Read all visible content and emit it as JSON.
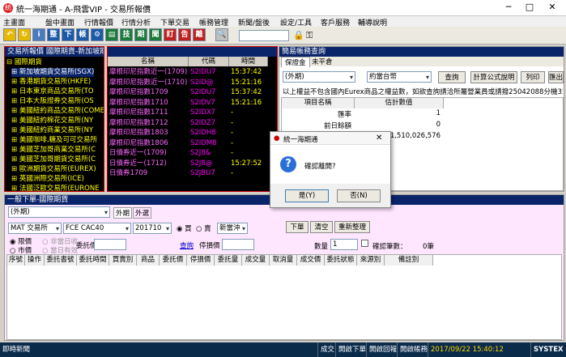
{
  "window": {
    "title": "統一海期通 - A-飛雲VIP - 交易所報價",
    "minimize": "─",
    "maximize": "□",
    "close": "✕"
  },
  "menu": [
    "主畫面",
    "盤中畫面",
    "行情報價",
    "行情分析",
    "下單交易",
    "帳務管理",
    "新聞/盤後",
    "設定/工具",
    "客戶服務",
    "輔導說明"
  ],
  "toolbar": {
    "buttons": [
      {
        "name": "return-icon",
        "glyph": "↶",
        "color": "#e6b800"
      },
      {
        "name": "refresh-icon",
        "glyph": "↻",
        "color": "#e6b800"
      },
      {
        "name": "news-icon",
        "glyph": "i",
        "color": "#4a7ac0"
      },
      {
        "name": "quote-icon",
        "glyph": "整",
        "color": "#1c5aa8"
      },
      {
        "name": "order-icon",
        "glyph": "下",
        "color": "#1c5aa8"
      },
      {
        "name": "account-icon",
        "glyph": "帳",
        "color": "#1c5aa8"
      },
      {
        "name": "settings-icon",
        "glyph": "⚙",
        "color": "#1c5aa8"
      },
      {
        "name": "chart-icon",
        "glyph": "▤",
        "color": "#1c7a3a"
      },
      {
        "name": "tech-icon",
        "glyph": "技",
        "color": "#1c7a3a"
      },
      {
        "name": "period-icon",
        "glyph": "期",
        "color": "#1c7a3a"
      },
      {
        "name": "news2-icon",
        "glyph": "聞",
        "color": "#1c7a3a"
      },
      {
        "name": "ticket-icon",
        "glyph": "訂",
        "color": "#c02020"
      },
      {
        "name": "notice-icon",
        "glyph": "告",
        "color": "#c02020"
      },
      {
        "name": "exit-icon",
        "glyph": "離",
        "color": "#c02020"
      },
      {
        "name": "search-icon",
        "glyph": "🔍",
        "color": "#c0c0c0"
      }
    ]
  },
  "left_panel": {
    "title": "交易所報價 國際期貨-新加坡期貨交易所(SGX)",
    "tree_root": "國際期貨",
    "tree": [
      "新加坡期貨交易所(SGX)",
      "香港期貨交易所(HKFE)",
      "日本東京商品交易所(TO",
      "日本大阪證券交易所(OS",
      "美國紐約商品交易所(COMEX",
      "美國紐約棉花交易所(NY",
      "美國紐約商業交易所(NY",
      "美國咖啡,糖及可可交易所",
      "美國芝加哥商業交易所(C",
      "美國芝加哥期貨交易所(C",
      "歐洲期貨交易所(EUREX)",
      "英國洲際交易所(ICE)",
      "法國泛歐交易所(EURONE"
    ]
  },
  "quote_table": {
    "headers": [
      "名稱",
      "代碼",
      "時間"
    ],
    "rows": [
      [
        "摩根印尼指數近一(1709)",
        "S2IDU7",
        "15:37:42"
      ],
      [
        "摩根印尼指數近一(1710)",
        "S2ID@",
        "15:21:16"
      ],
      [
        "摩根印尼指數1709",
        "S2IDU7",
        "15:37:42"
      ],
      [
        "摩根印尼指數1710",
        "S2IDV7",
        "15:21:16"
      ],
      [
        "摩根印尼指數1711",
        "S2IDX7",
        "-"
      ],
      [
        "摩根印尼指數1712",
        "S2IDZ7",
        "-"
      ],
      [
        "摩根印尼指數1803",
        "S2IDH8",
        "-"
      ],
      [
        "摩根印尼指數1806",
        "S2IDM8",
        "-"
      ],
      [
        "日債券近一(1709)",
        "S2J8&",
        "-"
      ],
      [
        "日債券近一(1712)",
        "S2J8@",
        "15:27:52"
      ],
      [
        "日債券1709",
        "S2JBU7",
        "-"
      ]
    ]
  },
  "account_panel": {
    "title": "簡易帳務查詢",
    "tabs": [
      "保證金",
      "未平倉"
    ],
    "market": "(外期)",
    "currency": "約當台幣",
    "buttons": [
      "查詢",
      "計算公式說明",
      "列印",
      "匯出"
    ],
    "notice": "以上權益不包含國內Eurex商品之權益數，如欲查詢請洽所屬營業員或請撥25042088分機354、3",
    "headers": [
      "項目名稱",
      "估計數值"
    ],
    "rows": [
      [
        "匯率",
        "1"
      ],
      [
        "前日餘額",
        "0"
      ],
      [
        "",
        "1,510,026,576"
      ]
    ]
  },
  "order_panel": {
    "title": "一般下單-國際期貨",
    "market": "(外期)",
    "tabs": [
      "外期",
      "外選"
    ],
    "exchange": "MAT 交易所",
    "product": "FCE  CAC40",
    "month": "201710",
    "side_buy": "買",
    "side_sell": "賣",
    "offset": "新當沖",
    "buttons": [
      "下單",
      "清空",
      "重新整理"
    ],
    "price_type_limit": "限價",
    "price_type_market": "市價",
    "cond_a": "非當日收",
    "cond_b": "當日有效",
    "price_label": "委託價",
    "query_link": "查詢",
    "stop_label": "停損價",
    "qty_label": "數量",
    "qty_value": "1",
    "order_no_label": "確認筆數：",
    "order_no_value": "0筆",
    "table_headers": [
      "序號",
      "操作",
      "委託書號",
      "委託時間",
      "買賣別",
      "商品",
      "委託價",
      "停損價",
      "委託量",
      "成交量",
      "取消量",
      "成交價",
      "委託狀態",
      "來源別",
      "備註別"
    ]
  },
  "dialog": {
    "title": "統一海期通",
    "message": "確認離開?",
    "yes": "是(Y)",
    "no": "否(N)"
  },
  "status": {
    "left": "即時新聞",
    "items": [
      "成交",
      "開啟下單",
      "開啟回報",
      "開啟帳務"
    ],
    "time": "2017/09/22 15:40:12",
    "brand": "SYSTEX"
  }
}
